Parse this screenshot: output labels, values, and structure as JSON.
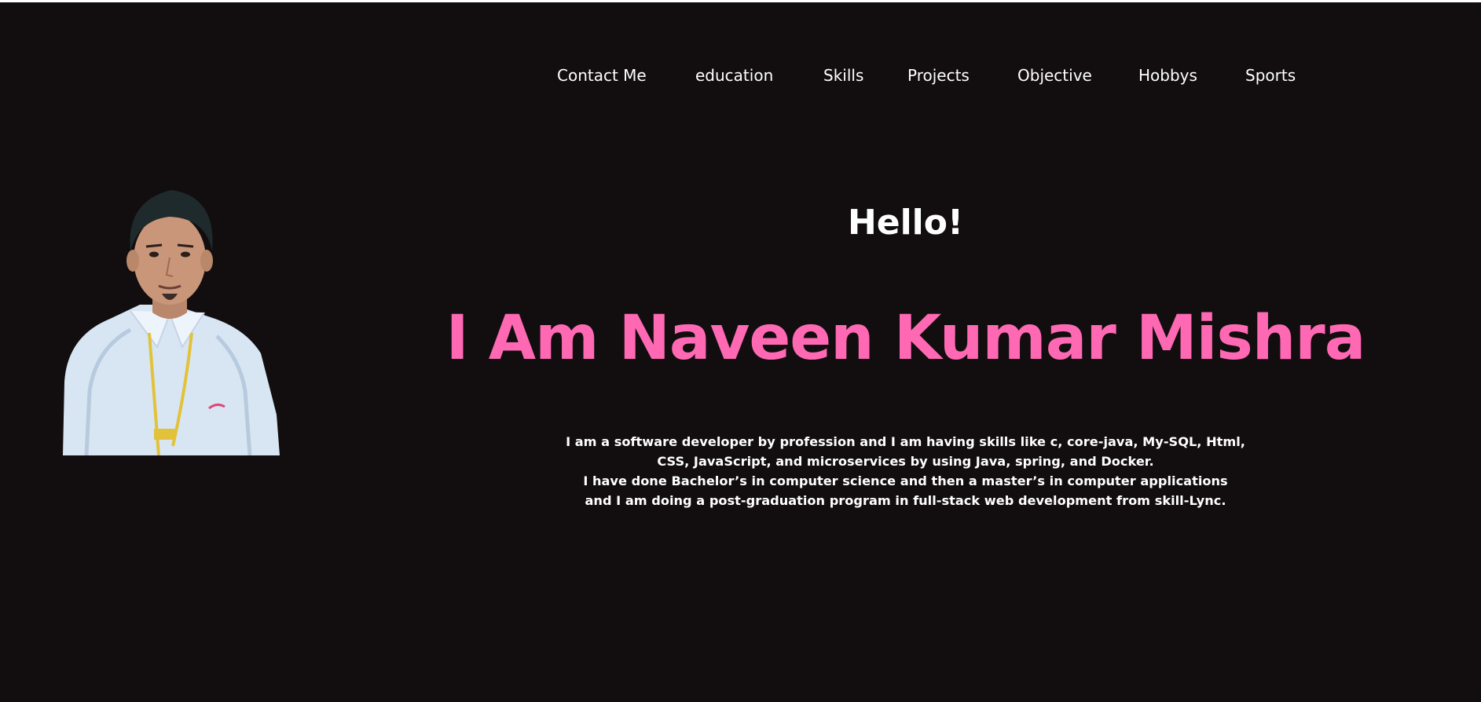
{
  "nav": {
    "items": [
      {
        "label": "Contact Me"
      },
      {
        "label": "education"
      },
      {
        "label": "Skills"
      },
      {
        "label": "Projects"
      },
      {
        "label": "Objective"
      },
      {
        "label": "Hobbys"
      },
      {
        "label": "Sports"
      }
    ]
  },
  "hero": {
    "greeting": "Hello!",
    "name": "I Am Naveen Kumar Mishra",
    "bio_lines": [
      "I am a software developer by profession and I am having skills like c, core-java, My-SQL, Html,",
      "CSS, JavaScript, and microservices by using Java, spring, and Docker.",
      "I have done Bachelor’s in computer science and then a master’s in computer applications",
      "and I am doing a post-graduation program in full-stack web development from skill-Lync."
    ]
  },
  "colors": {
    "background": "#120e0f",
    "accent": "#ff69b4",
    "text": "#ffffff"
  }
}
